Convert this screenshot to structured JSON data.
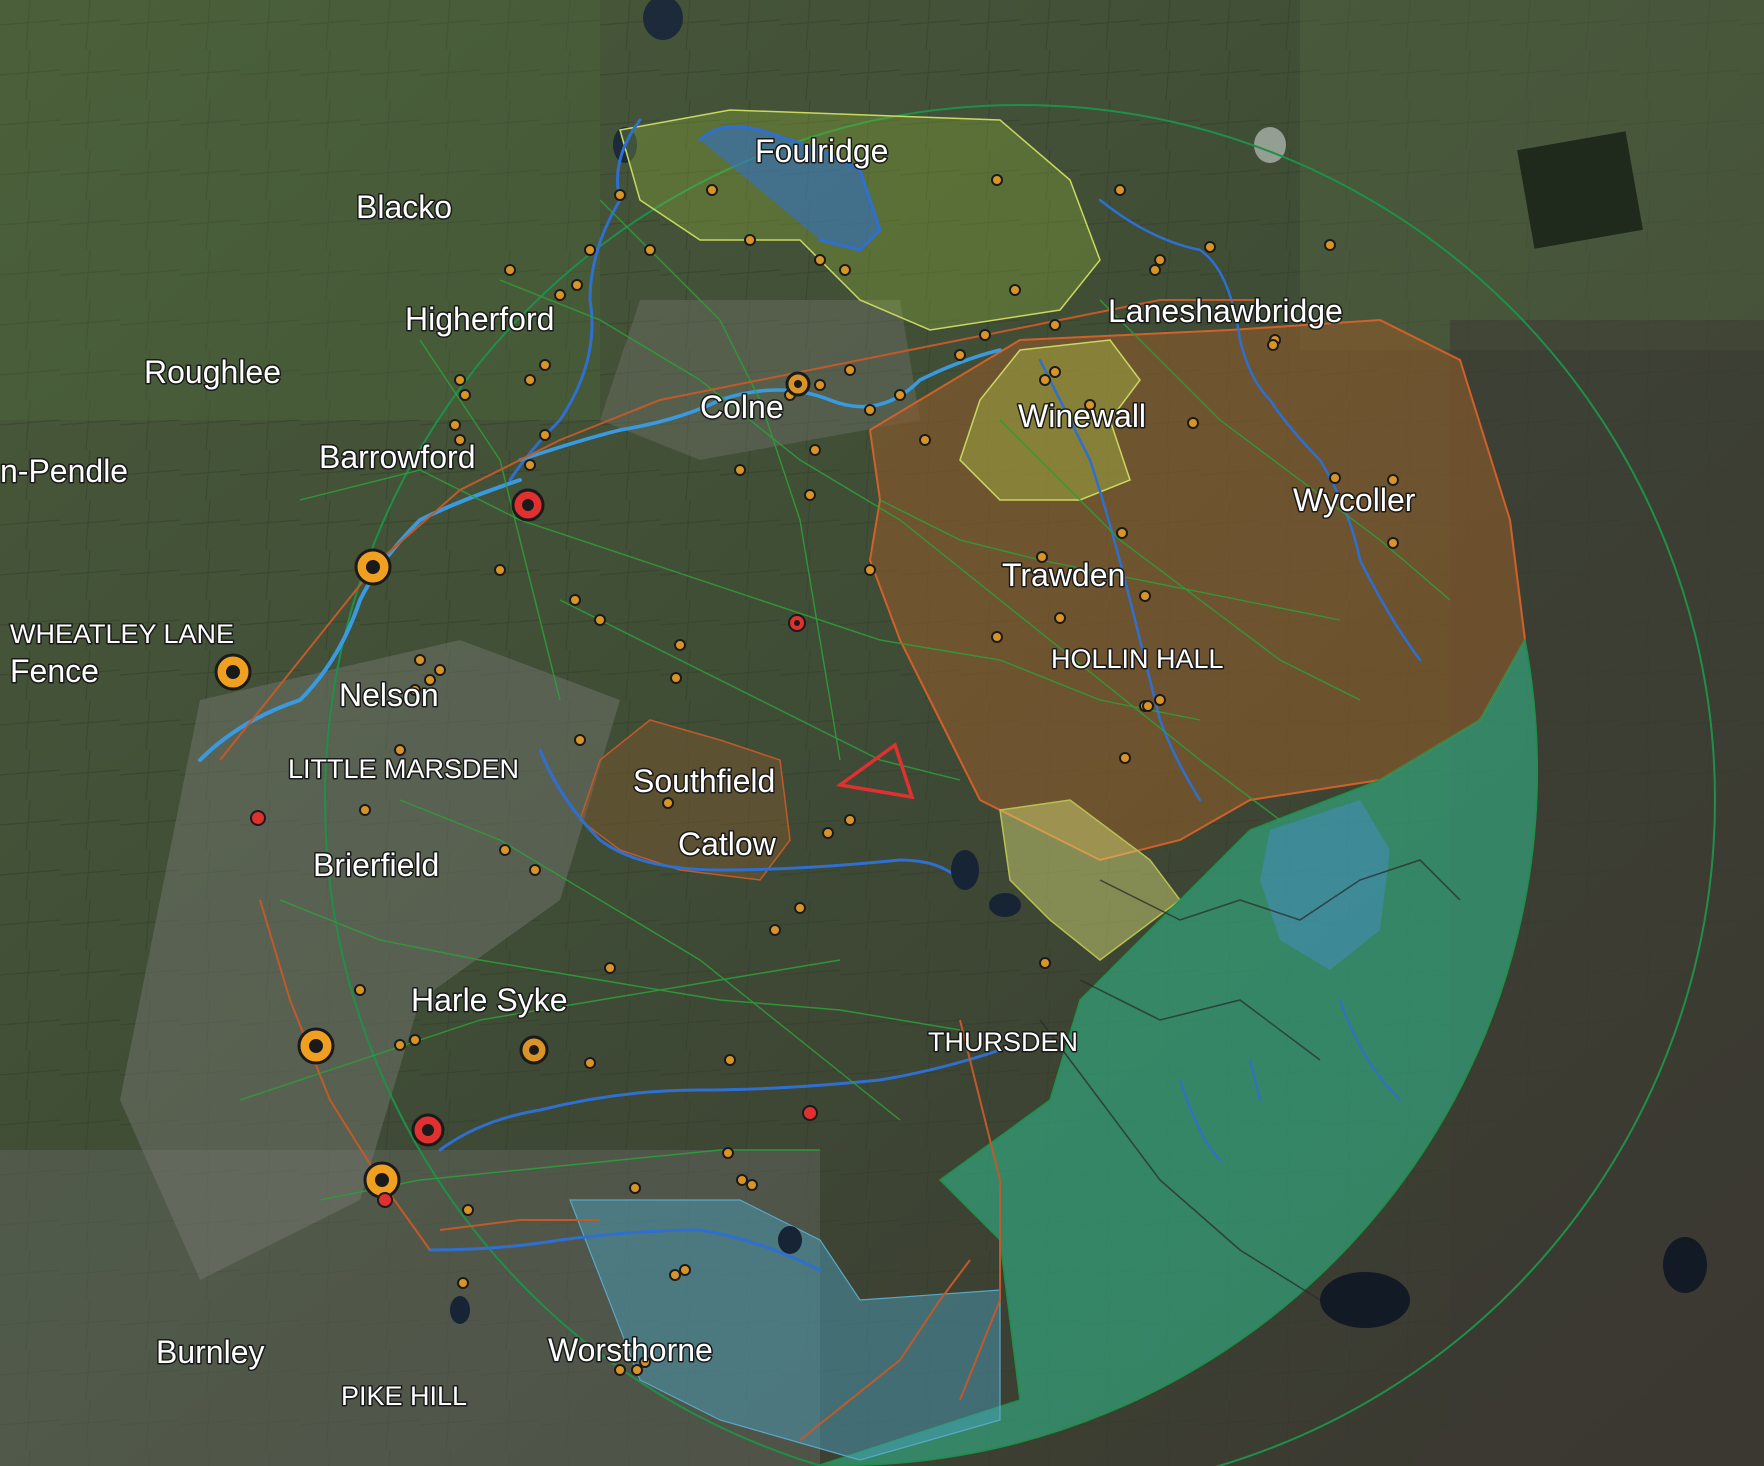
{
  "map": {
    "base_layer": "satellite-imagery",
    "place_labels": {
      "foulridge": "Foulridge",
      "blacko": "Blacko",
      "higherford": "Higherford",
      "roughlee": "Roughlee",
      "laneshawbridge": "Laneshawbridge",
      "colne": "Colne",
      "winewall": "Winewall",
      "barrowford": "Barrowford",
      "pendle": "n-Pendle",
      "wycoller": "Wycoller",
      "trawden": "Trawden",
      "wheatley_lane": "WHEATLEY LANE",
      "fence": "Fence",
      "hollin_hall": "HOLLIN HALL",
      "nelson": "Nelson",
      "southfield": "Southfield",
      "little_marsden": "LITTLE MARSDEN",
      "catlow": "Catlow",
      "brierfield": "Brierfield",
      "harle_syke": "Harle Syke",
      "thursden": "THURSDEN",
      "worsthorne": "Worsthorne",
      "burnley": "Burnley",
      "pike_hill": "PIKE HILL"
    },
    "colors": {
      "study_area_fill": "#2fbf8f",
      "moorland_fill": "#8a5a2c",
      "farmland_fill": "#9bc23a",
      "woodland_fill": "#4aa3c4",
      "water_course": "#2f6fd0",
      "footpath": "#2e9e3a",
      "road": "#c05a2a",
      "site_marker_orange": "#f0a020",
      "site_marker_red": "#e03030"
    }
  }
}
